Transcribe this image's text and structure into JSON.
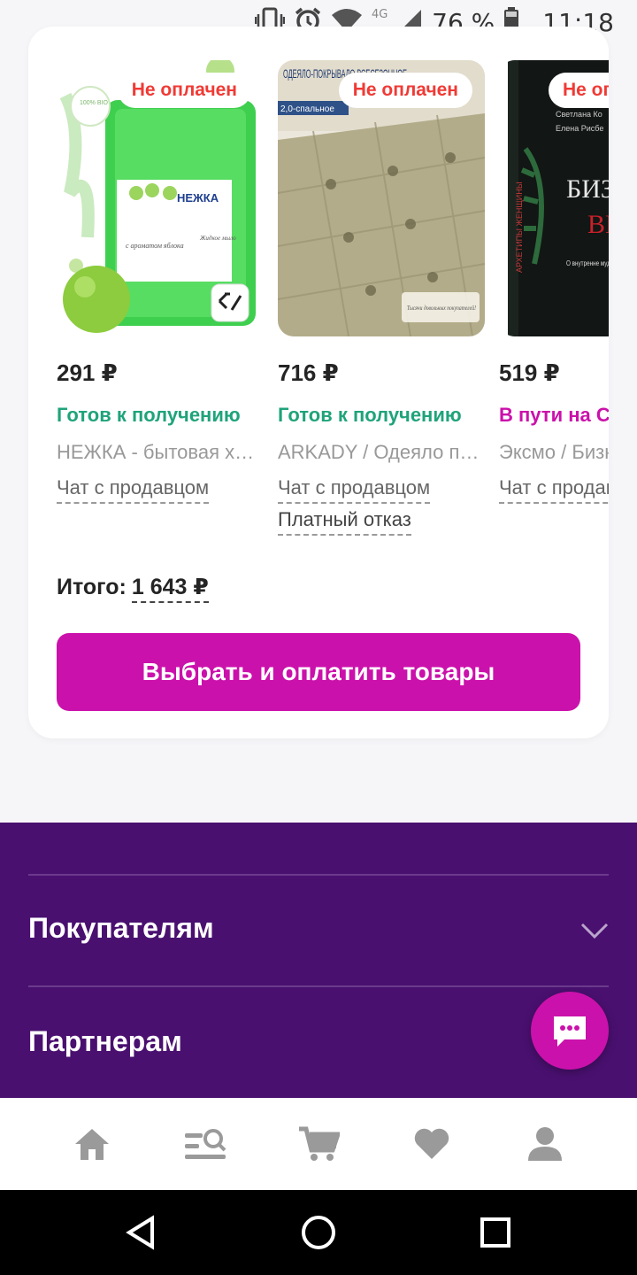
{
  "status_bar": {
    "network": "4G",
    "battery": "76 %",
    "time": "11:18"
  },
  "order": {
    "products": [
      {
        "badge": "Не оплачен",
        "price": "291 ₽",
        "status": "Готов к получению",
        "name": "НЕЖКА - бытовая химия",
        "chat": "Чат с продавцом",
        "image_text": {
          "brand": "НЕЖКА",
          "bio": "100% BIO",
          "caption": "с ароматом яблока",
          "type": "Жидкое мыло"
        }
      },
      {
        "badge": "Не оплачен",
        "price": "716 ₽",
        "status": "Готов к получению",
        "name": "ARKADY / Одеяло покрывало",
        "chat": "Чат с продавцом",
        "refuse": "Платный отказ",
        "image_text": {
          "title": "ОДЕЯЛО-ПОКРЫВАЛО ВСЕСЕЗОННОЕ",
          "size": "2,0-спальное",
          "slogan": "Тысячи довольных покупателей!"
        }
      },
      {
        "badge": "Не оплачен",
        "price": "519 ₽",
        "status": "В пути на С",
        "name": "Эксмо / Бизнес",
        "chat": "Чат с продавцом",
        "image_text": {
          "authors": [
            "Светлана Ко",
            "Елена Рисбе"
          ],
          "title1": "БИЗН",
          "title2": "ВЕД",
          "spine": "АРХЕТИПЫ ЖЕНЩИНЫ",
          "desc": "О внутренне мудрости и выбирать св"
        }
      }
    ],
    "total_label": "Итого:",
    "total_sum": "1 643 ₽",
    "pay_button": "Выбрать и оплатить товары"
  },
  "footer": {
    "buyers": "Покупателям",
    "partners": "Партнерам"
  },
  "colors": {
    "accent": "#cb11ab",
    "footer_bg": "#4a1070",
    "ready_green": "#1fa37a",
    "unpaid_red": "#f03a35"
  },
  "icons": {
    "bottom_nav": [
      "home-icon",
      "catalog-search-icon",
      "cart-icon",
      "heart-icon",
      "profile-icon"
    ],
    "android": [
      "back-icon",
      "home-circle-icon",
      "recents-icon"
    ]
  }
}
